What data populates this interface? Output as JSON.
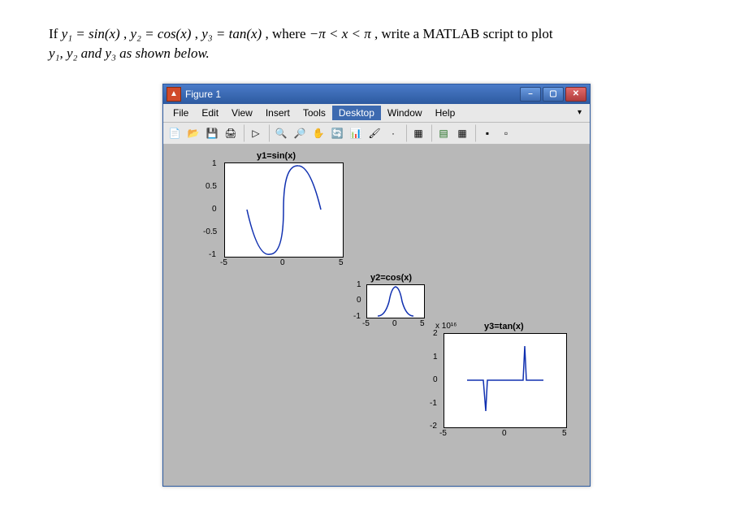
{
  "problem": {
    "prefix": "If ",
    "y1": "y₁ = sin(x)",
    "y2": "y₂ = cos(x)",
    "y3": "y₃ = tan(x)",
    "where": ", where ",
    "domain": "−π < x < π",
    "suffix": " , write a MATLAB script to plot ",
    "line2": "y₁, y₂ and y₃ as shown below."
  },
  "window": {
    "title": "Figure 1",
    "menu": [
      "File",
      "Edit",
      "View",
      "Insert",
      "Tools",
      "Desktop",
      "Window",
      "Help"
    ]
  },
  "plots": {
    "sin": {
      "title": "y1=sin(x)",
      "yticks": [
        "1",
        "0.5",
        "0",
        "-0.5",
        "-1"
      ],
      "xticks": [
        "-5",
        "0",
        "5"
      ]
    },
    "cos": {
      "title": "y2=cos(x)",
      "yticks": [
        "1",
        "0",
        "-1"
      ],
      "xticks": [
        "-5",
        "0",
        "5"
      ]
    },
    "tan": {
      "title": "y3=tan(x)",
      "scale": "x 10¹⁶",
      "yticks": [
        "2",
        "1",
        "0",
        "-1",
        "-2"
      ],
      "xticks": [
        "-5",
        "0",
        "5"
      ]
    }
  },
  "chart_data": [
    {
      "type": "line",
      "title": "y1=sin(x)",
      "xlabel": "",
      "ylabel": "",
      "xlim": [
        -5,
        5
      ],
      "ylim": [
        -1,
        1
      ],
      "series": [
        {
          "name": "sin(x)",
          "expr": "sin(x)",
          "domain": [
            -3.1416,
            3.1416
          ]
        }
      ]
    },
    {
      "type": "line",
      "title": "y2=cos(x)",
      "xlabel": "",
      "ylabel": "",
      "xlim": [
        -5,
        5
      ],
      "ylim": [
        -1,
        1
      ],
      "series": [
        {
          "name": "cos(x)",
          "expr": "cos(x)",
          "domain": [
            -3.1416,
            3.1416
          ]
        }
      ]
    },
    {
      "type": "line",
      "title": "y3=tan(x)",
      "xlabel": "",
      "ylabel": "",
      "xlim": [
        -5,
        5
      ],
      "ylim": [
        -2e+16,
        2e+16
      ],
      "y_scale_label": "x 10^16",
      "series": [
        {
          "name": "tan(x)",
          "expr": "tan(x)",
          "domain": [
            -3.1416,
            3.1416
          ]
        }
      ]
    }
  ]
}
